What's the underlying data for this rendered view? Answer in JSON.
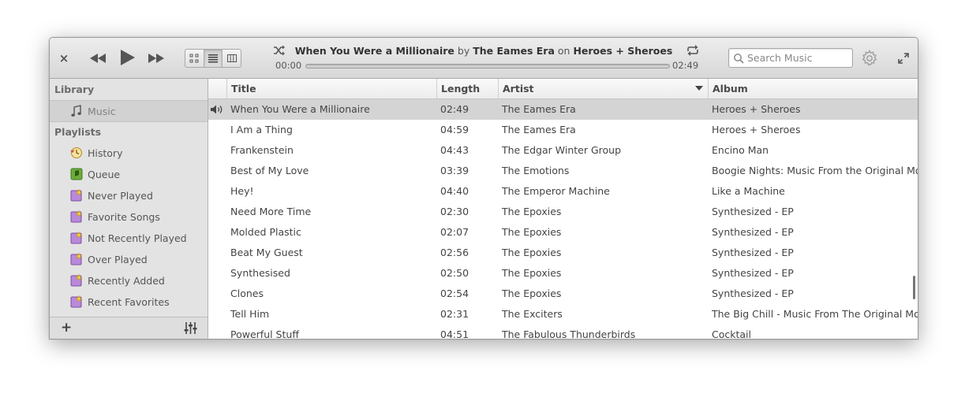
{
  "header": {
    "close_symbol": "×",
    "now_playing": {
      "title": "When You Were a Millionaire",
      "by": "by",
      "artist": "The Eames Era",
      "on": "on",
      "album": "Heroes + Sheroes"
    },
    "time_elapsed": "00:00",
    "time_total": "02:49",
    "progress_fraction": 0.0,
    "search_placeholder": "Search Music",
    "view_modes": [
      "grid-view-icon",
      "list-view-icon",
      "column-view-icon"
    ],
    "active_view": "list"
  },
  "sidebar": {
    "library_heading": "Library",
    "library_items": [
      {
        "label": "Music",
        "icon": "music-note-icon",
        "selected": true
      }
    ],
    "playlists_heading": "Playlists",
    "playlist_items": [
      {
        "label": "History",
        "icon": "history-icon"
      },
      {
        "label": "Queue",
        "icon": "queue-icon"
      },
      {
        "label": "Never Played",
        "icon": "smart-playlist-icon"
      },
      {
        "label": "Favorite Songs",
        "icon": "smart-playlist-icon"
      },
      {
        "label": "Not Recently Played",
        "icon": "smart-playlist-icon"
      },
      {
        "label": "Over Played",
        "icon": "smart-playlist-icon"
      },
      {
        "label": "Recently Added",
        "icon": "smart-playlist-icon"
      },
      {
        "label": "Recent Favorites",
        "icon": "smart-playlist-icon"
      }
    ],
    "add_symbol": "+"
  },
  "table": {
    "columns": [
      "Title",
      "Length",
      "Artist",
      "Album"
    ],
    "sorted_column": "Artist",
    "rows": [
      {
        "title": "When You Were a Millionaire",
        "length": "02:49",
        "artist": "The Eames Era",
        "album": "Heroes + Sheroes",
        "playing": true
      },
      {
        "title": "I Am a Thing",
        "length": "04:59",
        "artist": "The Eames Era",
        "album": "Heroes + Sheroes"
      },
      {
        "title": "Frankenstein",
        "length": "04:43",
        "artist": "The Edgar Winter Group",
        "album": "Encino Man"
      },
      {
        "title": "Best of My Love",
        "length": "03:39",
        "artist": "The Emotions",
        "album": "Boogie Nights: Music From the Original Motion"
      },
      {
        "title": "Hey!",
        "length": "04:40",
        "artist": "The Emperor Machine",
        "album": "Like a Machine"
      },
      {
        "title": "Need More Time",
        "length": "02:30",
        "artist": "The Epoxies",
        "album": "Synthesized - EP"
      },
      {
        "title": "Molded Plastic",
        "length": "02:07",
        "artist": "The Epoxies",
        "album": "Synthesized - EP"
      },
      {
        "title": "Beat My Guest",
        "length": "02:56",
        "artist": "The Epoxies",
        "album": "Synthesized - EP"
      },
      {
        "title": "Synthesised",
        "length": "02:50",
        "artist": "The Epoxies",
        "album": "Synthesized - EP"
      },
      {
        "title": "Clones",
        "length": "02:54",
        "artist": "The Epoxies",
        "album": "Synthesized - EP"
      },
      {
        "title": "Tell Him",
        "length": "02:31",
        "artist": "The Exciters",
        "album": "The Big Chill - Music From The Original Motion"
      },
      {
        "title": "Powerful Stuff",
        "length": "04:51",
        "artist": "The Fabulous Thunderbirds",
        "album": "Cocktail"
      }
    ]
  }
}
